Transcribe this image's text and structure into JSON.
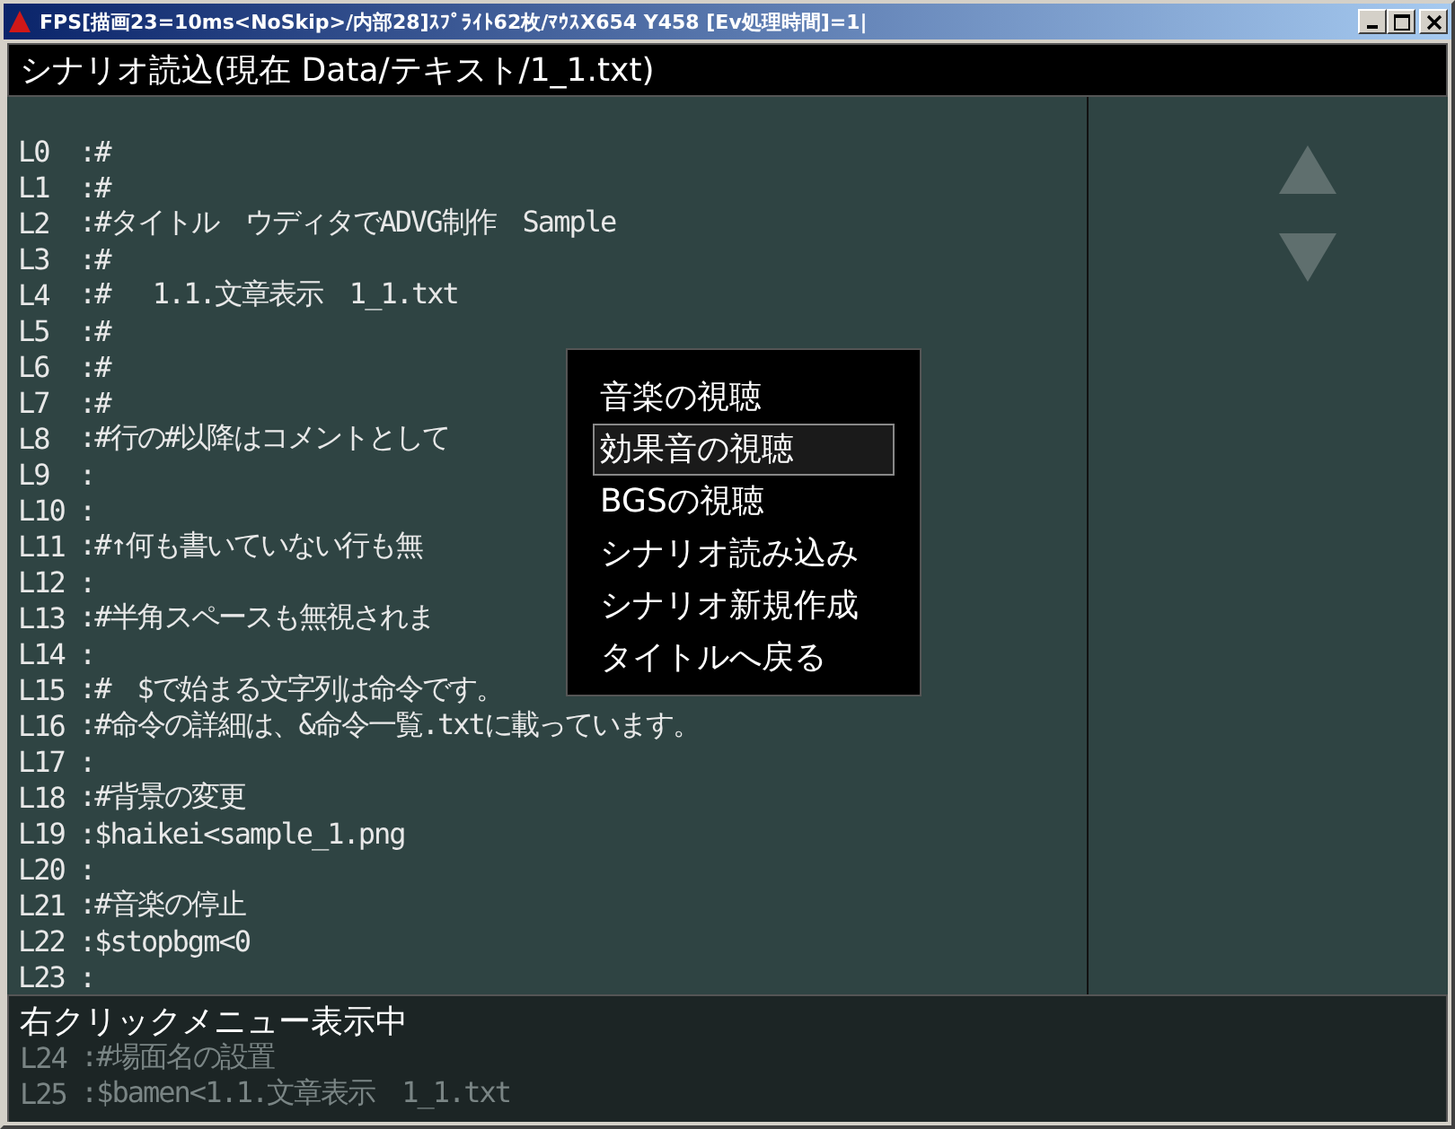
{
  "window": {
    "title": "FPS[描画23=10ms<NoSkip>/内部28]ｽﾌﾟﾗｲﾄ62枚/ﾏｳｽX654 Y458 [Ev処理時間]=1|"
  },
  "header": {
    "title": "シナリオ読込(現在 Data/テキスト/1_1.txt)"
  },
  "lines": [
    {
      "num": "L0",
      "text": ":#",
      "dimmed": false
    },
    {
      "num": "L1",
      "text": ":#",
      "dimmed": false
    },
    {
      "num": "L2",
      "text": ":#タイトル　ウディタでADVG制作　Sample",
      "dimmed": false
    },
    {
      "num": "L3",
      "text": ":#",
      "dimmed": false
    },
    {
      "num": "L4",
      "text": ":#　 1.1.文章表示　1_1.txt",
      "dimmed": false
    },
    {
      "num": "L5",
      "text": ":#",
      "dimmed": false
    },
    {
      "num": "L6",
      "text": ":#",
      "dimmed": false
    },
    {
      "num": "L7",
      "text": ":#",
      "dimmed": false
    },
    {
      "num": "L8",
      "text": ":#行の#以降はコメントとして",
      "dimmed": false
    },
    {
      "num": "L9",
      "text": ":",
      "dimmed": false
    },
    {
      "num": "L10",
      "text": ":",
      "dimmed": false
    },
    {
      "num": "L11",
      "text": ":#↑何も書いていない行も無",
      "dimmed": false
    },
    {
      "num": "L12",
      "text": ":",
      "dimmed": false
    },
    {
      "num": "L13",
      "text": ":#半角スペースも無視されま",
      "dimmed": false
    },
    {
      "num": "L14",
      "text": ":",
      "dimmed": false
    },
    {
      "num": "L15",
      "text": ":#　$で始まる文字列は命令です。",
      "dimmed": false
    },
    {
      "num": "L16",
      "text": ":#命令の詳細は、&命令一覧.txtに載っています。",
      "dimmed": false
    },
    {
      "num": "L17",
      "text": ":",
      "dimmed": false
    },
    {
      "num": "L18",
      "text": ":#背景の変更",
      "dimmed": false
    },
    {
      "num": "L19",
      "text": ":$haikei<sample_1.png",
      "dimmed": false
    },
    {
      "num": "L20",
      "text": ":",
      "dimmed": false
    },
    {
      "num": "L21",
      "text": ":#音楽の停止",
      "dimmed": false
    },
    {
      "num": "L22",
      "text": ":$stopbgm<0",
      "dimmed": false
    },
    {
      "num": "L23",
      "text": ":",
      "dimmed": false
    }
  ],
  "status": {
    "text": "右クリックメニュー表示中",
    "lines": [
      {
        "num": "L24",
        "text": ":#場面名の設置",
        "dimmed": true
      },
      {
        "num": "L25",
        "text": ":$bamen<1.1.文章表示　1_1.txt",
        "dimmed": true
      }
    ]
  },
  "menu": {
    "items": [
      {
        "label": "音楽の視聴",
        "selected": false
      },
      {
        "label": "効果音の視聴",
        "selected": true
      },
      {
        "label": "BGSの視聴",
        "selected": false
      },
      {
        "label": "シナリオ読み込み",
        "selected": false
      },
      {
        "label": "シナリオ新規作成",
        "selected": false
      },
      {
        "label": "タイトルへ戻る",
        "selected": false
      }
    ]
  }
}
